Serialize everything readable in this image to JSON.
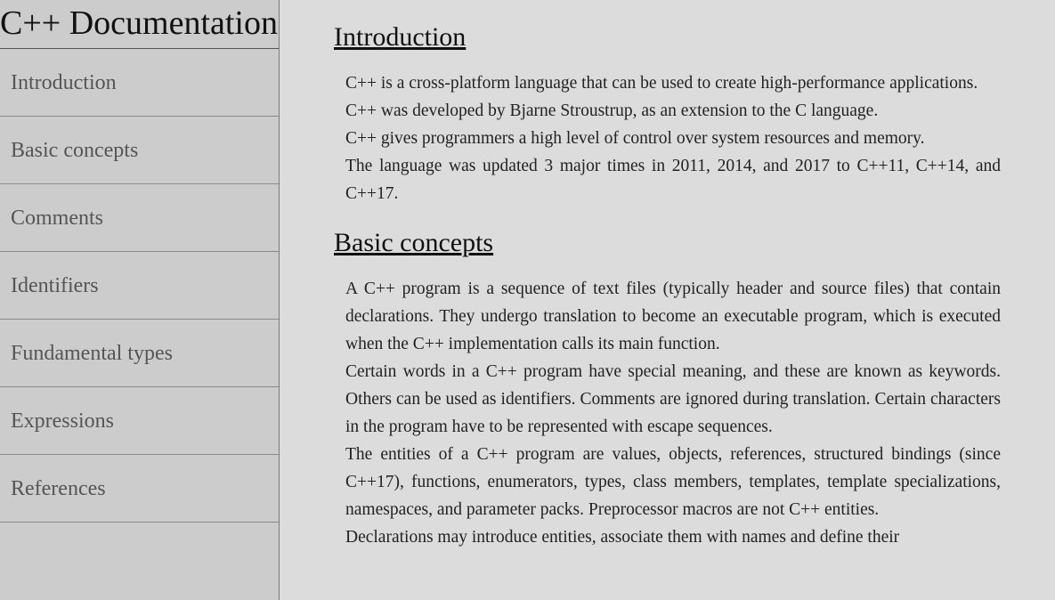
{
  "nav": {
    "title": "C++ Documentation",
    "items": [
      {
        "label": "Introduction"
      },
      {
        "label": "Basic concepts"
      },
      {
        "label": "Comments"
      },
      {
        "label": "Identifiers"
      },
      {
        "label": "Fundamental types"
      },
      {
        "label": "Expressions"
      },
      {
        "label": "References"
      }
    ]
  },
  "sections": [
    {
      "title": "Introduction",
      "paragraphs": [
        "C++ is a cross-platform language that can be used to create high-performance applications.",
        "C++ was developed by Bjarne Stroustrup, as an extension to the C language.",
        "C++ gives programmers a high level of control over system resources and memory.",
        "The language was updated 3 major times in 2011, 2014, and 2017 to C++11, C++14, and C++17."
      ]
    },
    {
      "title": "Basic concepts",
      "paragraphs": [
        "A C++ program is a sequence of text files (typically header and source files) that contain declarations. They undergo translation to become an executable program, which is executed when the C++ implementation calls its main function.",
        "Certain words in a C++ program have special meaning, and these are known as keywords. Others can be used as identifiers. Comments are ignored during translation. Certain characters in the program have to be represented with escape sequences.",
        "The entities of a C++ program are values, objects, references, structured bindings (since C++17), functions, enumerators, types, class members, templates, template specializations, namespaces, and parameter packs. Preprocessor macros are not C++ entities.",
        "Declarations may introduce entities, associate them with names and define their"
      ]
    }
  ]
}
